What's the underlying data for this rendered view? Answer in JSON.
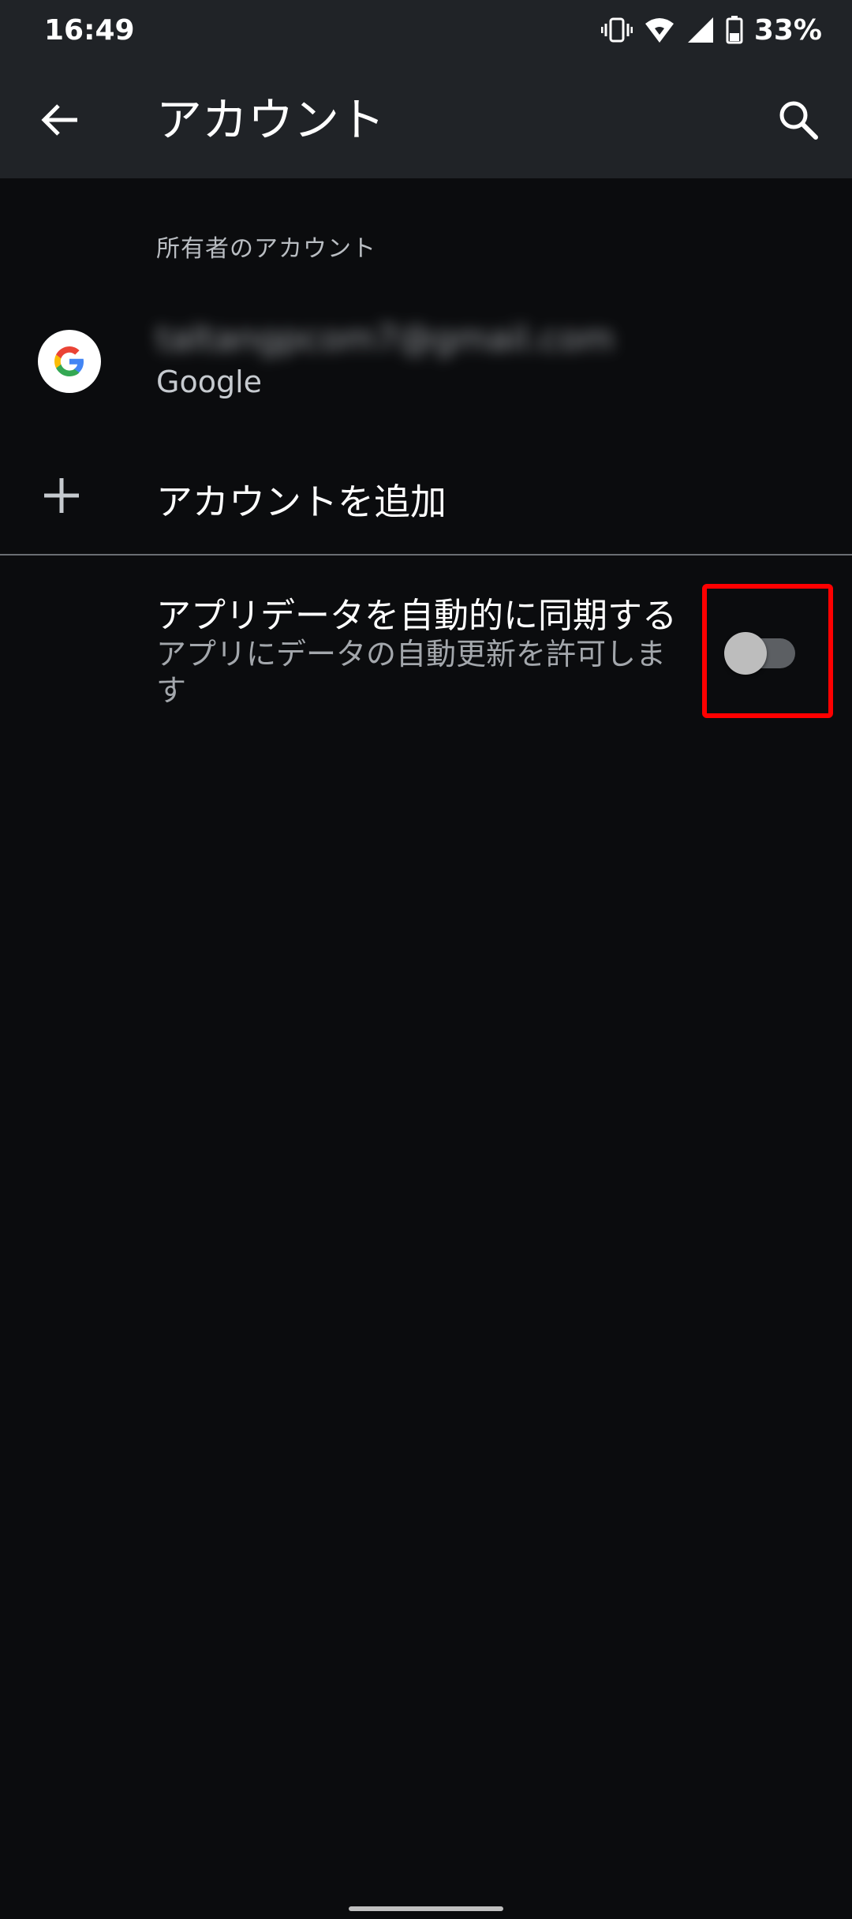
{
  "status_bar": {
    "time": "16:49",
    "battery_percent": "33%",
    "icons": [
      "vibrate-icon",
      "wifi-icon",
      "signal-icon",
      "battery-icon"
    ]
  },
  "app_bar": {
    "title": "アカウント",
    "back_icon": "back-arrow-icon",
    "search_icon": "search-icon"
  },
  "section": {
    "header": "所有者のアカウント"
  },
  "account": {
    "email": "taltangpcom7@gmail.com",
    "type": "Google",
    "icon": "google-logo-icon"
  },
  "add_account": {
    "label": "アカウントを追加",
    "icon": "plus-icon"
  },
  "sync": {
    "title": "アプリデータを自動的に同期する",
    "description": "アプリにデータの自動更新を許可します",
    "enabled": false
  },
  "colors": {
    "background": "#0b0c0e",
    "toolbar": "#202327",
    "highlight": "#ff0000",
    "toggle_track": "#5c5f63",
    "toggle_thumb": "#bdbdbd"
  }
}
